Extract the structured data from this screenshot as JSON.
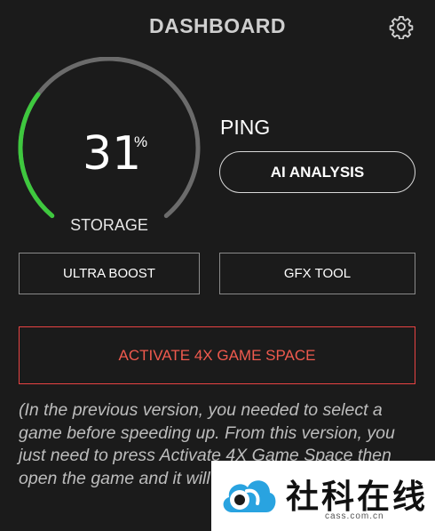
{
  "header": {
    "title": "DASHBOARD",
    "settings_icon": "gear-icon"
  },
  "gauge": {
    "value": "31",
    "unit": "%",
    "label": "STORAGE",
    "fraction": 0.31,
    "track_color": "#6b6b6b",
    "fill_color": "#3ec83e"
  },
  "ping": {
    "label": "PING"
  },
  "buttons": {
    "ai_analysis": "AI ANALYSIS",
    "ultra_boost": "ULTRA BOOST",
    "gfx_tool": "GFX TOOL",
    "activate": "ACTIVATE 4X GAME SPACE"
  },
  "note": {
    "text": "(In the previous version, you needed to select a game before speeding up. From this version, you just need to press Activate 4X Game Space then open the game and it will automatically optimize"
  },
  "watermark": {
    "text": "社科在线",
    "url": "cass.com.cn"
  },
  "colors": {
    "accent_red": "#e84343",
    "background": "#1b1b1b"
  }
}
